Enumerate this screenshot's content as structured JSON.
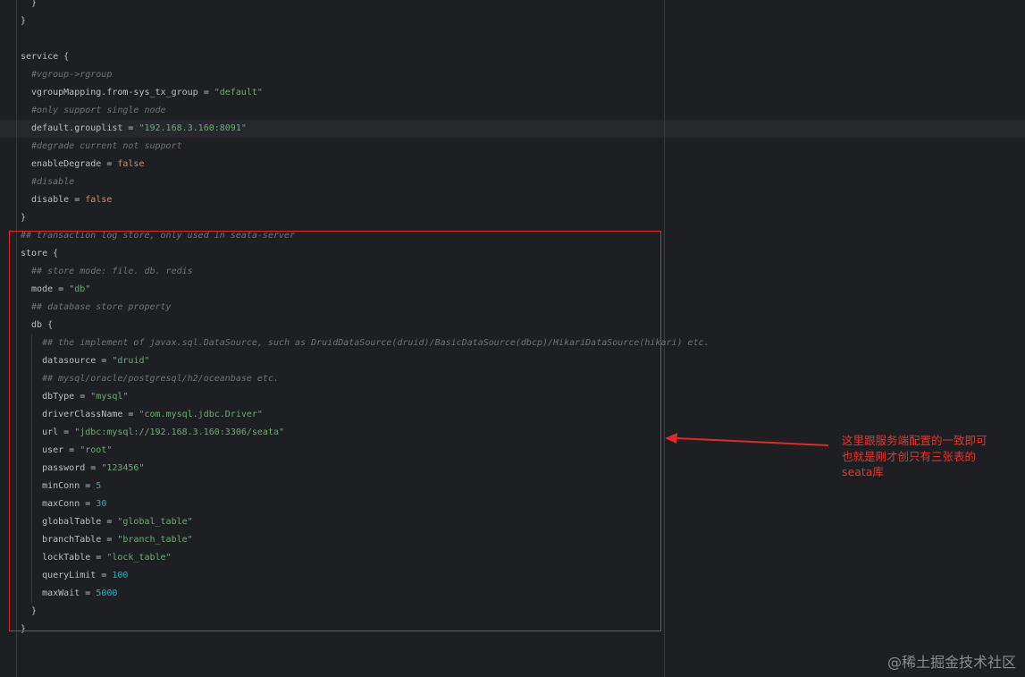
{
  "code": {
    "lines": [
      "  }",
      "}",
      "",
      "service {",
      "  #vgroup->rgroup",
      "  vgroupMapping.from-sys_tx_group = \"default\"",
      "  #only support single node",
      "  default.grouplist = \"192.168.3.160:8091\"",
      "  #degrade current not support",
      "  enableDegrade = false",
      "  #disable",
      "  disable = false",
      "}",
      "## transaction log store, only used in seata-server",
      "store {",
      "  ## store mode: file. db. redis",
      "  mode = \"db\"",
      "  ## database store property",
      "  db {",
      "    ## the implement of javax.sql.DataSource, such as DruidDataSource(druid)/BasicDataSource(dbcp)/HikariDataSource(hikari) etc.",
      "    datasource = \"druid\"",
      "    ## mysql/oracle/postgresql/h2/oceanbase etc.",
      "    dbType = \"mysql\"",
      "    driverClassName = \"com.mysql.jdbc.Driver\"",
      "    url = \"jdbc:mysql://192.168.3.160:3306/seata\"",
      "    user = \"root\"",
      "    password = \"123456\"",
      "    minConn = 5",
      "    maxConn = 30",
      "    globalTable = \"global_table\"",
      "    branchTable = \"branch_table\"",
      "    lockTable = \"lock_table\"",
      "    queryLimit = 100",
      "    maxWait = 5000",
      "  }",
      "}"
    ]
  },
  "annotation": {
    "text": "这里跟服务端配置的一致即可\n也就是刚才创只有三张表的\nseata库",
    "color": "#e8322f"
  },
  "watermark": "@稀土掘金技术社区"
}
